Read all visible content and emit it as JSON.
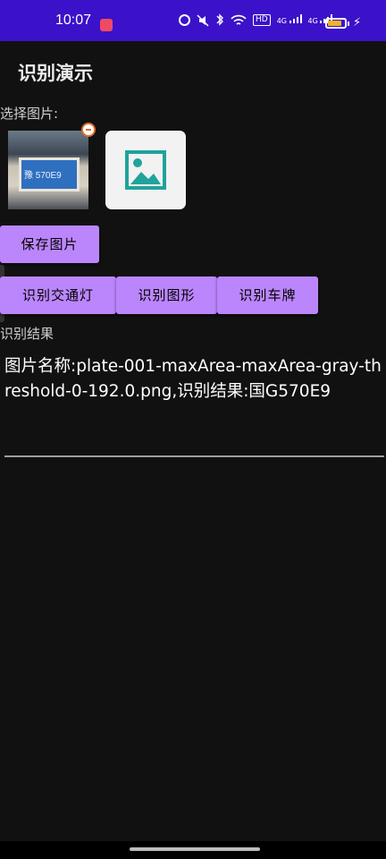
{
  "status_bar": {
    "time": "10:07",
    "signal_label_1": "4G",
    "signal_label_2": "4G",
    "hd_label": "HD",
    "battery_level": 0.85,
    "accent": "#3b12c9"
  },
  "app": {
    "title": "识别演示"
  },
  "picker": {
    "label": "选择图片:",
    "thumbnail_text": "豫 570E9"
  },
  "buttons": {
    "save": "保存图片",
    "traffic_light": "识别交通灯",
    "shape": "识别图形",
    "plate": "识别车牌"
  },
  "result": {
    "label": "识别结果",
    "text": "图片名称:plate-001-maxArea-maxArea-gray-threshold-0-192.0.png,识别结果:国G570E9"
  },
  "colors": {
    "background": "#111111",
    "button": "#bb86fc",
    "image_icon": "#1fa39b"
  }
}
